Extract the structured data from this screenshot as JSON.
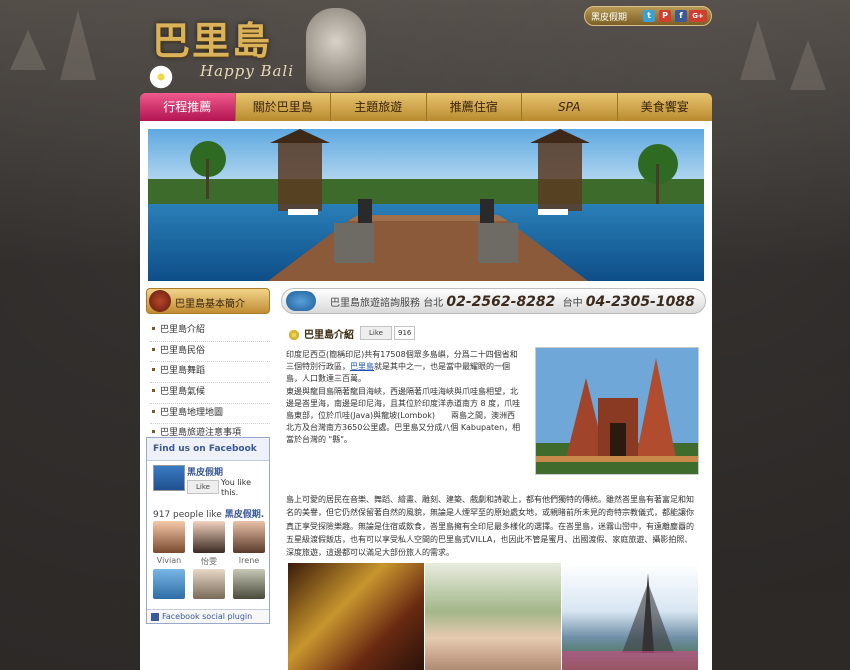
{
  "header": {
    "logo_title": "巴里島",
    "logo_subtitle": "Happy Bali",
    "top_link": "黑皮假期",
    "social": [
      "f",
      "P",
      "t",
      "G+"
    ]
  },
  "nav": {
    "items": [
      "行程推薦",
      "關於巴里島",
      "主題旅遊",
      "推薦住宿",
      "SPA",
      "美食饗宴"
    ]
  },
  "sidebar": {
    "title": "巴里島基本簡介",
    "items": [
      "巴里島介紹",
      "巴里島民俗",
      "巴里島舞蹈",
      "巴里島氣候",
      "巴里島地理地圖",
      "巴里島旅遊注意事項"
    ]
  },
  "facebook": {
    "header": "Find us on Facebook",
    "page_name": "黑皮假期",
    "like_label": "Like",
    "you_like": "You like this.",
    "count_text": "917 people like",
    "count_page": "黑皮假期.",
    "faces": [
      "Vivian",
      "怡雯",
      "Irene",
      "",
      "",
      ""
    ],
    "footer": "Facebook social plugin"
  },
  "service": {
    "label": "巴里島旅遊諮詢服務",
    "taipei_label": "台北",
    "taipei_phone": "02-2562-8282",
    "taichung_label": "台中",
    "taichung_phone": "04-2305-1088"
  },
  "article": {
    "title": "巴里島介紹",
    "like_label": "Like",
    "like_count": "916",
    "para1_a": "印度尼西亞(簡稱印尼)共有17508個眾多島嶼，分爲二十四個省和三個特別行政區，",
    "para1_link": "巴里島",
    "para1_b": "就是其中之一，也是當中最耀眼的一個島，人口數達三百萬。",
    "para1_c": "東邊與龍目島隔著龍目海峽，西邊隔著爪哇海峽與爪哇島相望，北邊是峇里海，南邊是印尼海，且其位於印度洋赤道南方 8 度，爪哇島東部，位於爪哇(Java)與龍坡(Lombok)　　兩島之間，澳洲西北方及台灣南方3650公里處。巴里島又分成八個 Kabupaten，相當於台灣的 \"縣\"。",
    "para2": "島上可愛的居民在音樂、舞蹈、繪畫、雕刻、建築、戲劇和詩歌上，都有他們獨特的傳統。雖然峇里島有著富足和知名的美譽，但它仍然保留著自然的風貌，無論是人煙罕至的原始處女地，或親睹前所未見的奇特宗教儀式，都能讓你真正享受探險樂趣。無論是住宿或飲食，峇里島擁有全印尼最多樣化的選擇。在峇里島，迷霧山巒中，有遠離塵囂的五星級渡假飯店，也有可以享受私人空間的巴里島式VILLA，也因此不管是蜜月、出國渡假、家庭旅遊、攝影拍照、深度旅遊，這邊都可以滿足大部份旅人的需求。"
  }
}
